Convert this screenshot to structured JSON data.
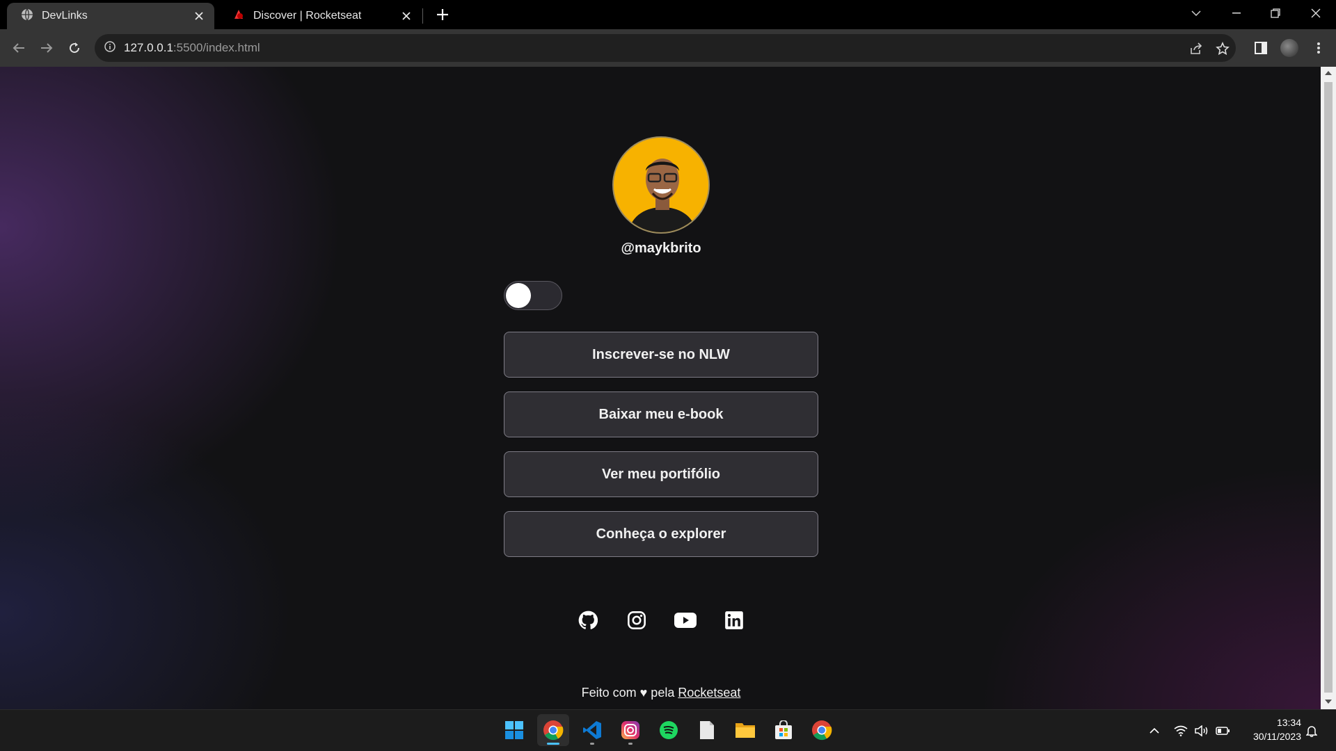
{
  "browser": {
    "tabs": [
      {
        "title": "DevLinks",
        "icon": "globe-icon",
        "active": true
      },
      {
        "title": "Discover | Rocketseat",
        "icon": "rocketseat-icon",
        "active": false
      }
    ],
    "url_host": "127.0.0.1",
    "url_rest": ":5500/index.html"
  },
  "page": {
    "username": "@maykbrito",
    "theme_switch_on": false,
    "links": [
      {
        "label": "Inscrever-se no NLW"
      },
      {
        "label": "Baixar meu e-book"
      },
      {
        "label": "Ver meu portifólio"
      },
      {
        "label": "Conheça o explorer"
      }
    ],
    "social": [
      "github-icon",
      "instagram-icon",
      "youtube-icon",
      "linkedin-icon"
    ],
    "footer": {
      "prefix": "Feito com ♥ pela ",
      "link": "Rocketseat"
    }
  },
  "taskbar": {
    "apps": [
      "windows-start-icon",
      "chrome-icon",
      "vscode-icon",
      "instagram-app-icon",
      "spotify-icon",
      "notepad-icon",
      "file-explorer-icon",
      "microsoft-store-icon",
      "chrome-icon"
    ],
    "time": "13:34",
    "date": "30/11/2023"
  },
  "colors": {
    "accent_purple": "#583278",
    "page_bg": "#121214",
    "button_bg": "#323136",
    "button_border": "#7e7c86"
  }
}
